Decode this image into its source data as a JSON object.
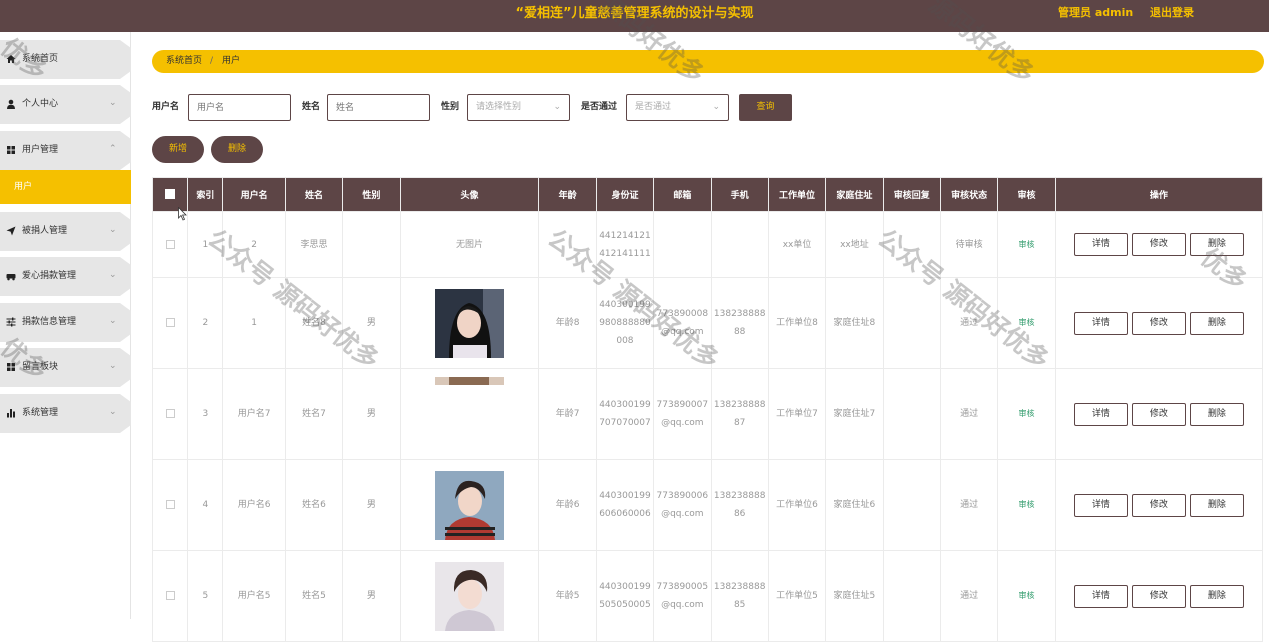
{
  "header": {
    "title": "“爱相连”儿童慈善管理系统的设计与实现",
    "admin_label": "管理员 admin",
    "logout_label": "退出登录"
  },
  "sidebar": {
    "items": [
      {
        "label": "系统首页",
        "icon": "home-icon"
      },
      {
        "label": "个人中心",
        "icon": "person-icon"
      },
      {
        "label": "用户管理",
        "icon": "grid-icon"
      },
      {
        "label": "被捐人管理",
        "icon": "send-icon"
      },
      {
        "label": "爱心捐款管理",
        "icon": "car-icon"
      },
      {
        "label": "捐款信息管理",
        "icon": "sliders-icon"
      },
      {
        "label": "留言板块",
        "icon": "grid-icon"
      },
      {
        "label": "系统管理",
        "icon": "bar-chart-icon"
      }
    ],
    "active_subitem": "用户"
  },
  "breadcrumb": {
    "home": "系统首页",
    "separator": "/",
    "current": "用户"
  },
  "search": {
    "username_label": "用户名",
    "username_placeholder": "用户名",
    "name_label": "姓名",
    "name_placeholder": "姓名",
    "gender_label": "性别",
    "gender_placeholder": "请选择性别",
    "passed_label": "是否通过",
    "passed_placeholder": "是否通过",
    "query_button": "查询"
  },
  "actions": {
    "add_button": "新增",
    "delete_button": "删除"
  },
  "table": {
    "columns": [
      "",
      "索引",
      "用户名",
      "姓名",
      "性别",
      "头像",
      "年龄",
      "身份证",
      "邮箱",
      "手机",
      "工作单位",
      "家庭住址",
      "审核回复",
      "审核状态",
      "审核",
      "操作"
    ],
    "review_link": "审核",
    "op_buttons": {
      "detail": "详情",
      "edit": "修改",
      "delete": "删除"
    },
    "rows": [
      {
        "index": "1",
        "username": "2",
        "name": "李思思",
        "gender": "",
        "avatar": "无图片",
        "age": "",
        "id_card": "441214121412141111",
        "email": "",
        "phone": "",
        "work": "xx单位",
        "address": "xx地址",
        "reply": "",
        "status": "待审核"
      },
      {
        "index": "2",
        "username": "1",
        "name": "姓名8",
        "gender": "男",
        "avatar": "",
        "age": "年龄8",
        "id_card": "440300199980888880008",
        "email": "773890008@qq.com",
        "phone": "13823888888",
        "work": "工作单位8",
        "address": "家庭住址8",
        "reply": "",
        "status": "通过"
      },
      {
        "index": "3",
        "username": "用户名7",
        "name": "姓名7",
        "gender": "男",
        "avatar": "",
        "age": "年龄7",
        "id_card": "440300199707070007",
        "email": "773890007@qq.com",
        "phone": "13823888887",
        "work": "工作单位7",
        "address": "家庭住址7",
        "reply": "",
        "status": "通过"
      },
      {
        "index": "4",
        "username": "用户名6",
        "name": "姓名6",
        "gender": "男",
        "avatar": "",
        "age": "年龄6",
        "id_card": "440300199606060006",
        "email": "773890006@qq.com",
        "phone": "13823888886",
        "work": "工作单位6",
        "address": "家庭住址6",
        "reply": "",
        "status": "通过"
      },
      {
        "index": "5",
        "username": "用户名5",
        "name": "姓名5",
        "gender": "男",
        "avatar": "",
        "age": "年龄5",
        "id_card": "440300199505050005",
        "email": "773890005@qq.com",
        "phone": "13823888885",
        "work": "工作单位5",
        "address": "家庭住址5",
        "reply": "",
        "status": "通过"
      }
    ]
  },
  "watermarks": [
    "公众号 源码好优多",
    "源码好优多",
    "优多"
  ],
  "colors": {
    "brand_brown": "#5d4546",
    "accent_yellow": "#f5c000",
    "review_green": "#2e9a6a"
  }
}
